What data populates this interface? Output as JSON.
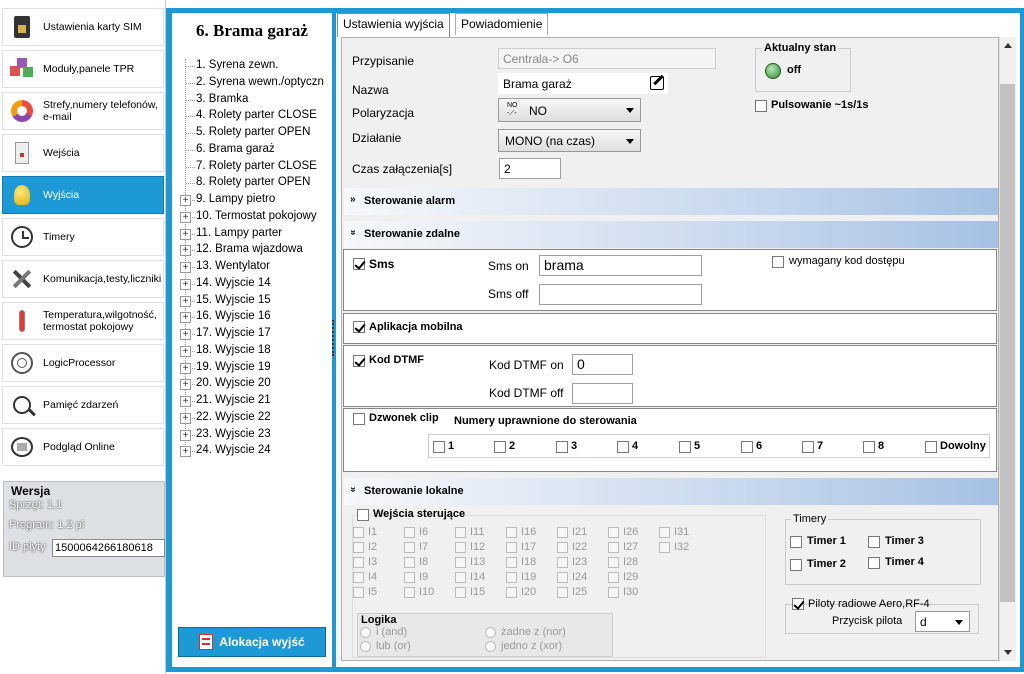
{
  "nav": {
    "items": [
      {
        "label": "Ustawienia karty SIM",
        "icon": "sim-card-icon"
      },
      {
        "label": "Moduły,panele TPR",
        "icon": "modules-icon"
      },
      {
        "label": "Strefy,numery telefonów, e-mail",
        "icon": "zones-icon"
      },
      {
        "label": "Wejścia",
        "icon": "inputs-icon"
      },
      {
        "label": "Wyjścia",
        "icon": "bulb-icon"
      },
      {
        "label": "Timery",
        "icon": "clock-icon"
      },
      {
        "label": "Komunikacja,testy,liczniki",
        "icon": "tools-icon"
      },
      {
        "label": "Temperatura,wilgotność, termostat pokojowy",
        "icon": "thermometer-icon"
      },
      {
        "label": "LogicProcessor",
        "icon": "brain-icon"
      },
      {
        "label": "Pamięć zdarzeń",
        "icon": "history-icon"
      },
      {
        "label": "Podgląd Online",
        "icon": "monitor-icon"
      }
    ],
    "selected_index": 4
  },
  "version": {
    "title": "Wersja",
    "hardware": "Sprzęt: 1.1",
    "program": "Program: 1.2 pl",
    "board_id_label": "ID płyty",
    "board_id": "1500064266180618"
  },
  "tree": {
    "title": "6. Brama garaż",
    "items": [
      {
        "label": "1. Syrena zewn.",
        "expandable": false
      },
      {
        "label": "2. Syrena wewn./optyczn",
        "expandable": false
      },
      {
        "label": "3. Bramka",
        "expandable": false
      },
      {
        "label": "4. Rolety parter CLOSE",
        "expandable": false
      },
      {
        "label": "5. Rolety parter OPEN",
        "expandable": false
      },
      {
        "label": "6. Brama garaż",
        "expandable": false
      },
      {
        "label": "7. Rolety parter CLOSE",
        "expandable": false
      },
      {
        "label": "8. Rolety parter OPEN",
        "expandable": false
      },
      {
        "label": "9. Lampy pietro",
        "expandable": true
      },
      {
        "label": "10. Termostat pokojowy",
        "expandable": true
      },
      {
        "label": "11. Lampy parter",
        "expandable": true
      },
      {
        "label": "12. Brama wjazdowa",
        "expandable": true
      },
      {
        "label": "13. Wentylator",
        "expandable": true
      },
      {
        "label": "14. Wyjscie 14",
        "expandable": true
      },
      {
        "label": "15. Wyjscie 15",
        "expandable": true
      },
      {
        "label": "16. Wyjscie 16",
        "expandable": true
      },
      {
        "label": "17. Wyjscie 17",
        "expandable": true
      },
      {
        "label": "18. Wyjscie 18",
        "expandable": true
      },
      {
        "label": "19. Wyjscie 19",
        "expandable": true
      },
      {
        "label": "20. Wyjscie 20",
        "expandable": true
      },
      {
        "label": "21. Wyjscie 21",
        "expandable": true
      },
      {
        "label": "22. Wyjscie 22",
        "expandable": true
      },
      {
        "label": "23. Wyjscie 23",
        "expandable": true
      },
      {
        "label": "24. Wyjscie 24",
        "expandable": true
      }
    ],
    "allocation_button": "Alokacja wyjść"
  },
  "tabs": [
    "Ustawienia wyjścia",
    "Powiadomienie"
  ],
  "form": {
    "assignment_label": "Przypisanie",
    "assignment_value": "Centrala-> O6",
    "name_label": "Nazwa",
    "name_value": "Brama garaż",
    "polarity_label": "Polaryzacja",
    "polarity_value": "NO",
    "action_label": "Działanie",
    "action_value": "MONO (na czas)",
    "time_label": "Czas załączenia[s]",
    "time_value": "2",
    "state_title": "Aktualny stan",
    "state_value": "off",
    "pulse_label": "Pulsowanie ~1s/1s"
  },
  "alarm_section": "Sterowanie alarm",
  "remote_section": {
    "title": "Sterowanie zdalne",
    "sms_label": "Sms",
    "sms_on_label": "Sms on",
    "sms_on_value": "brama",
    "sms_off_label": "Sms off",
    "sms_off_value": "",
    "access_code_label": "wymagany kod dostępu",
    "mobile_label": "Aplikacja mobilna",
    "dtmf_label": "Kod DTMF",
    "dtmf_on_label": "Kod DTMF on",
    "dtmf_on_value": "0",
    "dtmf_off_label": "Kod DTMF off",
    "dtmf_off_value": "",
    "clip_label": "Dzwonek clip",
    "numbers_title": "Numery uprawnione do sterowania",
    "numbers": [
      "1",
      "2",
      "3",
      "4",
      "5",
      "6",
      "7",
      "8",
      "Dowolny"
    ]
  },
  "local_section": {
    "title": "Sterowanie lokalne",
    "inputs_label": "Wejścia sterujące",
    "inputs": [
      "I1",
      "I6",
      "I11",
      "I16",
      "I21",
      "I26",
      "I31",
      "I2",
      "I7",
      "I12",
      "I17",
      "I22",
      "I27",
      "I32",
      "I3",
      "I8",
      "I13",
      "I18",
      "I23",
      "I28",
      "",
      "I4",
      "I9",
      "I14",
      "I19",
      "I24",
      "I29",
      "",
      "I5",
      "I10",
      "I15",
      "I20",
      "I25",
      "I30",
      ""
    ],
    "logic_title": "Logika",
    "logic_options": [
      "i (and)",
      "żadne z (nor)",
      "lub (or)",
      "jedno z (xor)"
    ],
    "timers_title": "Timery",
    "timers": [
      "Timer 1",
      "Timer 3",
      "Timer 2",
      "Timer 4"
    ],
    "remotes_label": "Piloty radiowe Aero,RF-4",
    "remote_button_label": "Przycisk pilota",
    "remote_button_value": "d"
  }
}
